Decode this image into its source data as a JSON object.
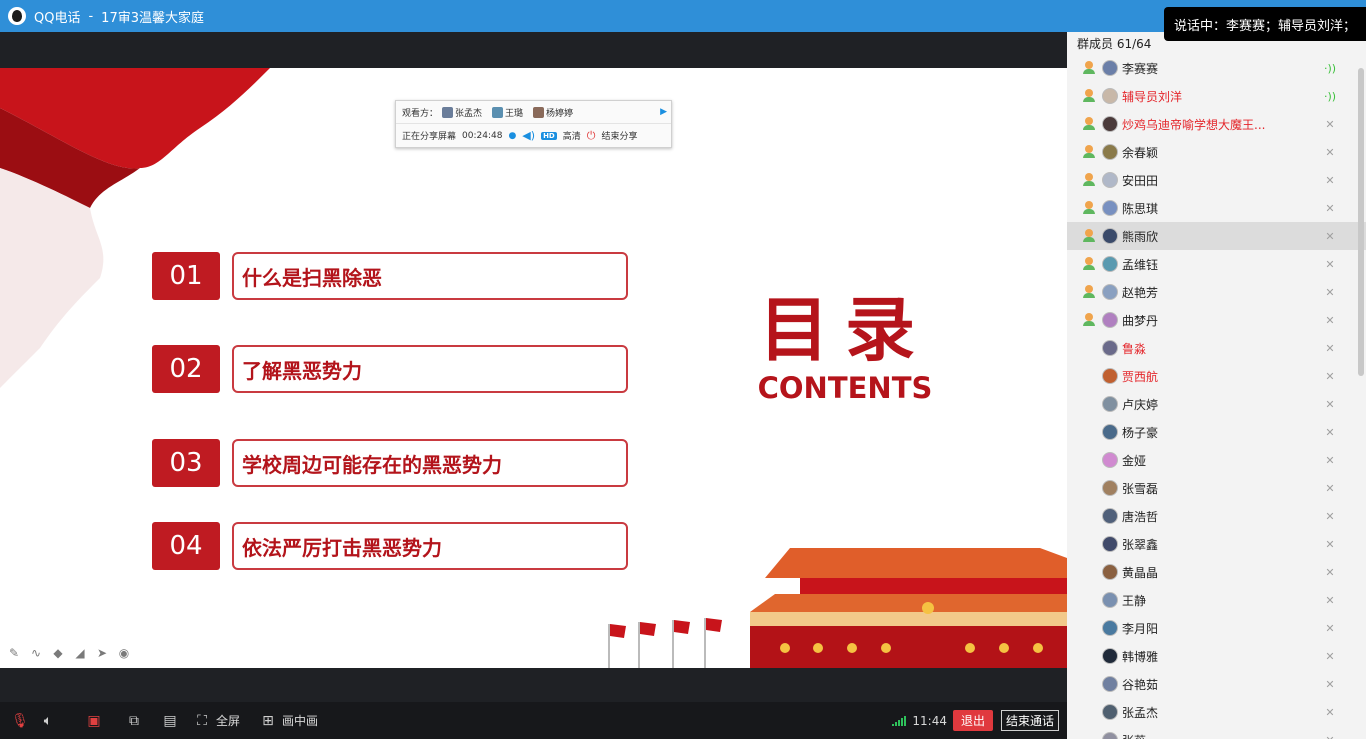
{
  "titlebar": {
    "app": "QQ电话",
    "separator": "-",
    "group": "17审3温馨大家庭"
  },
  "speaking_banner": "说话中：李赛赛；辅导员刘洋；",
  "viewer_bar": {
    "viewers_label": "观看方：",
    "viewers": [
      "张孟杰",
      "王璐",
      "杨婷婷"
    ],
    "sharing_label": "正在分享屏幕",
    "duration": "00:24:48",
    "hd_badge": "HD",
    "hd_label": "高清",
    "end_share": "结束分享",
    "icons": [
      "mic-icon",
      "speaker-icon",
      "power-icon",
      "arrow-right-icon"
    ]
  },
  "slide": {
    "items": [
      {
        "num": "01",
        "label": "什么是扫黑除恶"
      },
      {
        "num": "02",
        "label": "了解黑恶势力"
      },
      {
        "num": "03",
        "label": "学校周边可能存在的黑恶势力"
      },
      {
        "num": "04",
        "label": "依法严厉打击黑恶势力"
      }
    ],
    "title": "目录",
    "subtitle": "CONTENTS",
    "colors": {
      "accent_red": "#bf1b22",
      "corner_orange": "#f08b1c"
    }
  },
  "annotation_tools": [
    "pen-icon",
    "curve-icon",
    "highlighter-icon",
    "eraser-icon",
    "pointer-icon",
    "record-icon"
  ],
  "toolbar": {
    "fullscreen": "全屏",
    "pip": "画中画",
    "time": "11:44",
    "exit": "退出",
    "end_call": "结束通话",
    "icons": [
      "mic-muted-icon",
      "speaker-icon",
      "camera-off-icon",
      "screen-share-icon",
      "chat-icon",
      "fullscreen-icon",
      "pip-icon",
      "signal-icon"
    ]
  },
  "members": {
    "title": "群成员 61/64",
    "list": [
      {
        "name": "李赛赛",
        "red": false,
        "online": true,
        "speaking": true
      },
      {
        "name": "辅导员刘洋",
        "red": true,
        "online": true,
        "speaking": true
      },
      {
        "name": "炒鸡乌迪帝喻学想大魔王...",
        "red": true,
        "online": true,
        "speaking": false
      },
      {
        "name": "余春颖",
        "red": false,
        "online": true,
        "speaking": false
      },
      {
        "name": "安田田",
        "red": false,
        "online": true,
        "speaking": false
      },
      {
        "name": "陈思琪",
        "red": false,
        "online": true,
        "speaking": false
      },
      {
        "name": "熊雨欣",
        "red": false,
        "online": true,
        "speaking": false,
        "selected": true
      },
      {
        "name": "孟维钰",
        "red": false,
        "online": true,
        "speaking": false
      },
      {
        "name": "赵艳芳",
        "red": false,
        "online": true,
        "speaking": false
      },
      {
        "name": "曲梦丹",
        "red": false,
        "online": true,
        "speaking": false
      },
      {
        "name": "鲁淼",
        "red": true,
        "online": false,
        "speaking": false
      },
      {
        "name": "贾西航",
        "red": true,
        "online": false,
        "speaking": false
      },
      {
        "name": "卢庆婷",
        "red": false,
        "online": false,
        "speaking": false
      },
      {
        "name": "杨子豪",
        "red": false,
        "online": false,
        "speaking": false
      },
      {
        "name": "金娅",
        "red": false,
        "online": false,
        "speaking": false
      },
      {
        "name": "张雪磊",
        "red": false,
        "online": false,
        "speaking": false
      },
      {
        "name": "唐浩哲",
        "red": false,
        "online": false,
        "speaking": false
      },
      {
        "name": "张翠鑫",
        "red": false,
        "online": false,
        "speaking": false
      },
      {
        "name": "黄晶晶",
        "red": false,
        "online": false,
        "speaking": false
      },
      {
        "name": "王静",
        "red": false,
        "online": false,
        "speaking": false
      },
      {
        "name": "李月阳",
        "red": false,
        "online": false,
        "speaking": false
      },
      {
        "name": "韩博雅",
        "red": false,
        "online": false,
        "speaking": false
      },
      {
        "name": "谷艳茹",
        "red": false,
        "online": false,
        "speaking": false
      },
      {
        "name": "张孟杰",
        "red": false,
        "online": false,
        "speaking": false
      },
      {
        "name": "张蕊",
        "red": false,
        "online": false,
        "speaking": false
      }
    ]
  }
}
